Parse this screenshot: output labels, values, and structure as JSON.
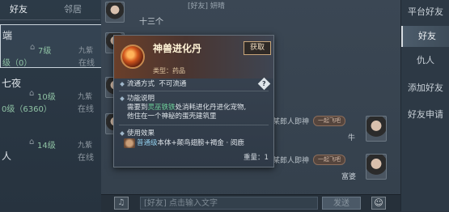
{
  "left_panel": {
    "tabs": [
      "好友",
      "邻居"
    ],
    "entries": [
      {
        "name": "端",
        "level_small": "7级",
        "badge": "九紫",
        "level": "级（0）",
        "status": "在线"
      },
      {
        "name": "七夜",
        "level_small": "10级",
        "badge": "九紫",
        "level": "0级（6360）",
        "status": "在线"
      },
      {
        "name": "人",
        "level_small": "14级",
        "badge": "九紫",
        "level": "",
        "status": "在线"
      }
    ]
  },
  "chat": {
    "header_text": "[好友] 妍晴",
    "sub_text": "十三个",
    "msg_text_1": "某郎人即神",
    "msg_text_2": "某郎人即神",
    "tag_1": "一起飞吧",
    "tag_2": "一起飞吧",
    "name_1": "牛",
    "name_2": "富婆",
    "input_prefix": "[好友]",
    "input_placeholder": "点击输入文字",
    "send_label": "发送"
  },
  "right_nav": {
    "items": [
      "平台好友",
      "好友",
      "仇人",
      "添加好友",
      "好友申请"
    ],
    "active_index": 1
  },
  "tooltip": {
    "title": "神兽进化丹",
    "action_label": "获取",
    "type_line": "类型：药品",
    "circulation_label": "流通方式",
    "circulation_value": "不可流通",
    "question_mark": "?",
    "func_title": "功能说明",
    "func_line1_pre": "需要到",
    "func_line1_npc": "灵巫铁铁",
    "func_line1_post": "处消耗进化丹进化宠物,",
    "func_line2": "他住在一个神秘的蛋壳建筑里",
    "effect_title": "使用效果",
    "effect_tier": "普通级",
    "effect_desc": "本体+颠鸟翅膀+褐金 · 阅鹿",
    "weight": "重量：1"
  }
}
